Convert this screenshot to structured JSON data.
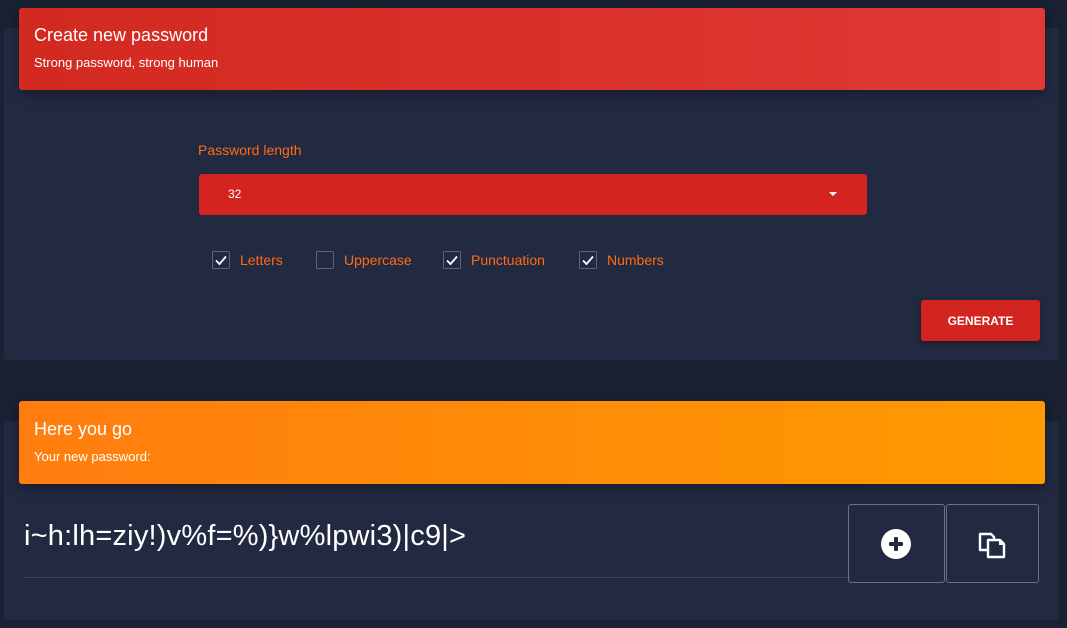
{
  "generator": {
    "title": "Create new password",
    "subtitle": "Strong password, strong human",
    "length_label": "Password length",
    "length_value": "32",
    "options": [
      {
        "label": "Letters",
        "checked": true
      },
      {
        "label": "Uppercase",
        "checked": false
      },
      {
        "label": "Punctuation",
        "checked": true
      },
      {
        "label": "Numbers",
        "checked": true
      }
    ],
    "generate_label": "GENERATE"
  },
  "result": {
    "title": "Here you go",
    "subtitle": "Your new password:",
    "password": "i~h:lh=ziy!)v%f=%)}w%lpwi3)|c9|>"
  },
  "colors": {
    "background": "#1a2133",
    "card": "#222a42",
    "red_accent": "#d42420",
    "orange_accent": "#ff8a00",
    "label_orange": "#ff6a14"
  },
  "icons": {
    "add": "plus-circle-icon",
    "copy": "copy-icon",
    "dropdown": "caret-down-icon",
    "check": "checkmark-icon"
  }
}
